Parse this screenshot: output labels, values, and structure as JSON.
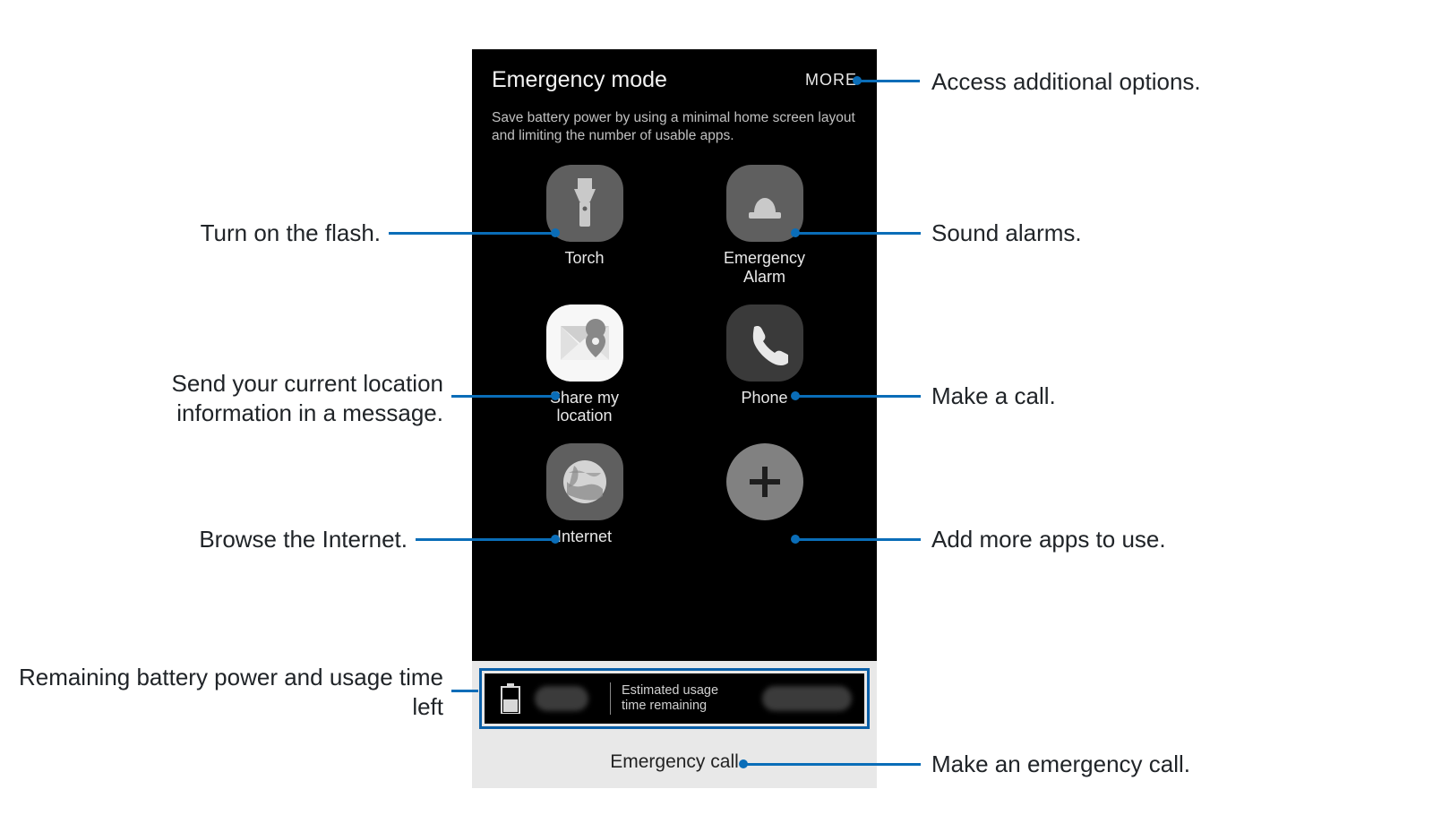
{
  "screen": {
    "title": "Emergency mode",
    "more_label": "MORE",
    "description": "Save battery power by using a minimal home screen layout and limiting the number of usable apps.",
    "apps": {
      "torch": "Torch",
      "alarm_line1": "Emergency",
      "alarm_line2": "Alarm",
      "share_line1": "Share my",
      "share_line2": "location",
      "phone": "Phone",
      "internet": "Internet"
    },
    "status": {
      "estimated_label_line1": "Estimated usage",
      "estimated_label_line2": "time remaining"
    },
    "emergency_call": "Emergency call"
  },
  "callouts": {
    "more": "Access additional options.",
    "torch": "Turn on the flash.",
    "alarm": "Sound alarms.",
    "share": "Send your current location information in a message.",
    "phone": "Make a call.",
    "internet": "Browse the Internet.",
    "add": "Add more apps to use.",
    "battery": "Remaining battery power and usage time left",
    "ecall": "Make an emergency call."
  }
}
